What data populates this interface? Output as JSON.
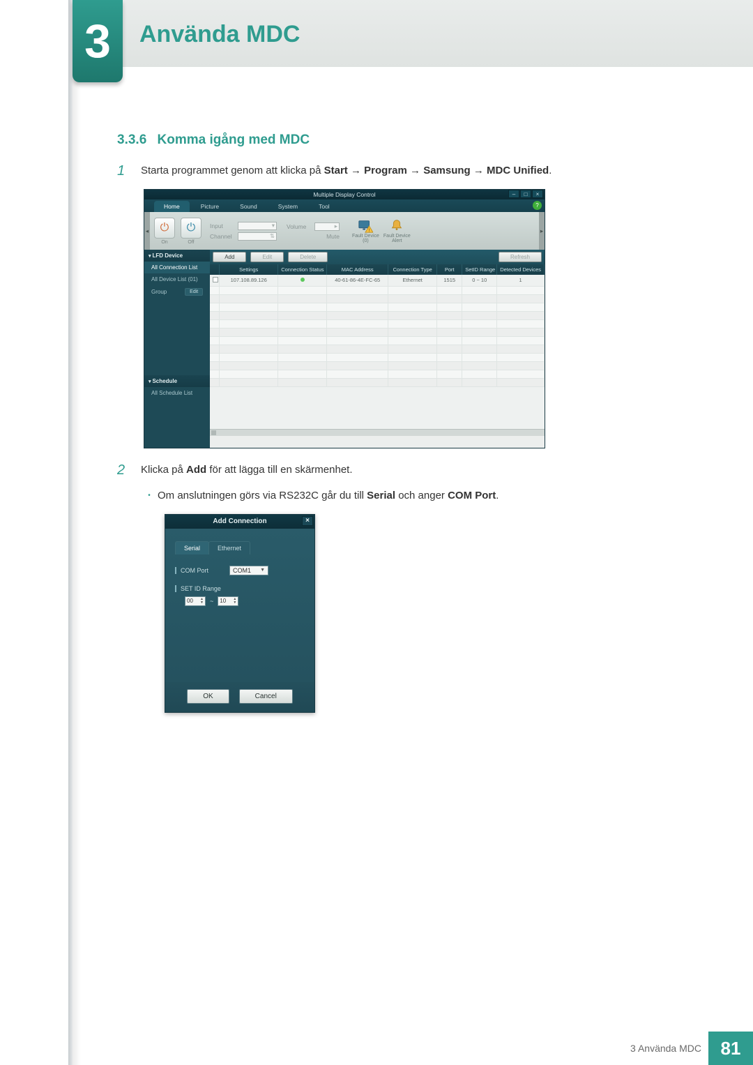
{
  "chapter": {
    "number": "3",
    "title": "Använda MDC"
  },
  "section": {
    "number": "3.3.6",
    "title": "Komma igång med MDC"
  },
  "steps": {
    "s1": {
      "num": "1",
      "pre": "Starta programmet genom att klicka på ",
      "b1": "Start",
      "arr1": " → ",
      "b2": "Program",
      "arr2": " → ",
      "b3": "Samsung",
      "arr3": " → ",
      "b4": "MDC Unified",
      "post": "."
    },
    "s2": {
      "num": "2",
      "pre": "Klicka på ",
      "b1": "Add",
      "post": " för att lägga till en skärmenhet.",
      "bullet": {
        "dot": "•",
        "pre": "Om anslutningen görs via RS232C går du till ",
        "b1": "Serial",
        "mid": " och anger ",
        "b2": "COM Port",
        "post": "."
      }
    }
  },
  "mdc": {
    "title": "Multiple Display Control",
    "win": {
      "min": "–",
      "max": "□",
      "close": "×"
    },
    "tabs": {
      "home": "Home",
      "picture": "Picture",
      "sound": "Sound",
      "system": "System",
      "tool": "Tool"
    },
    "help": "?",
    "toolbar": {
      "on": "On",
      "off": "Off",
      "input_lbl": "Input",
      "channel_lbl": "Channel",
      "volume_lbl": "Volume",
      "mute_lbl": "Mute",
      "fault1a": "Fault Device",
      "fault1b": "(0)",
      "fault2a": "Fault Device",
      "fault2b": "Alert"
    },
    "side": {
      "lfd": "LFD Device",
      "all_conn": "All Connection List",
      "all_dev": "All Device List (01)",
      "group": "Group",
      "edit": "Edit",
      "schedule": "Schedule",
      "all_sched": "All Schedule List"
    },
    "btns": {
      "add": "Add",
      "edit": "Edit",
      "delete": "Delete",
      "refresh": "Refresh"
    },
    "cols": {
      "settings": "Settings",
      "status": "Connection Status",
      "mac": "MAC Address",
      "ctype": "Connection Type",
      "port": "Port",
      "range": "SetID Range",
      "det": "Detected Devices"
    },
    "row1": {
      "ip": "107.108.89.126",
      "mac": "40-61-86-4E-FC-65",
      "ctype": "Ethernet",
      "port": "1515",
      "range": "0 ~ 10",
      "det": "1"
    }
  },
  "adddlg": {
    "title": "Add Connection",
    "close": "×",
    "tabs": {
      "serial": "Serial",
      "eth": "Ethernet"
    },
    "comport_lbl": "COM Port",
    "comport_val": "COM1",
    "range_lbl": "SET ID Range",
    "range_from": "00",
    "range_sep": "~",
    "range_to": "10",
    "ok": "OK",
    "cancel": "Cancel"
  },
  "footer": {
    "text": "3  Använda MDC",
    "page": "81"
  }
}
